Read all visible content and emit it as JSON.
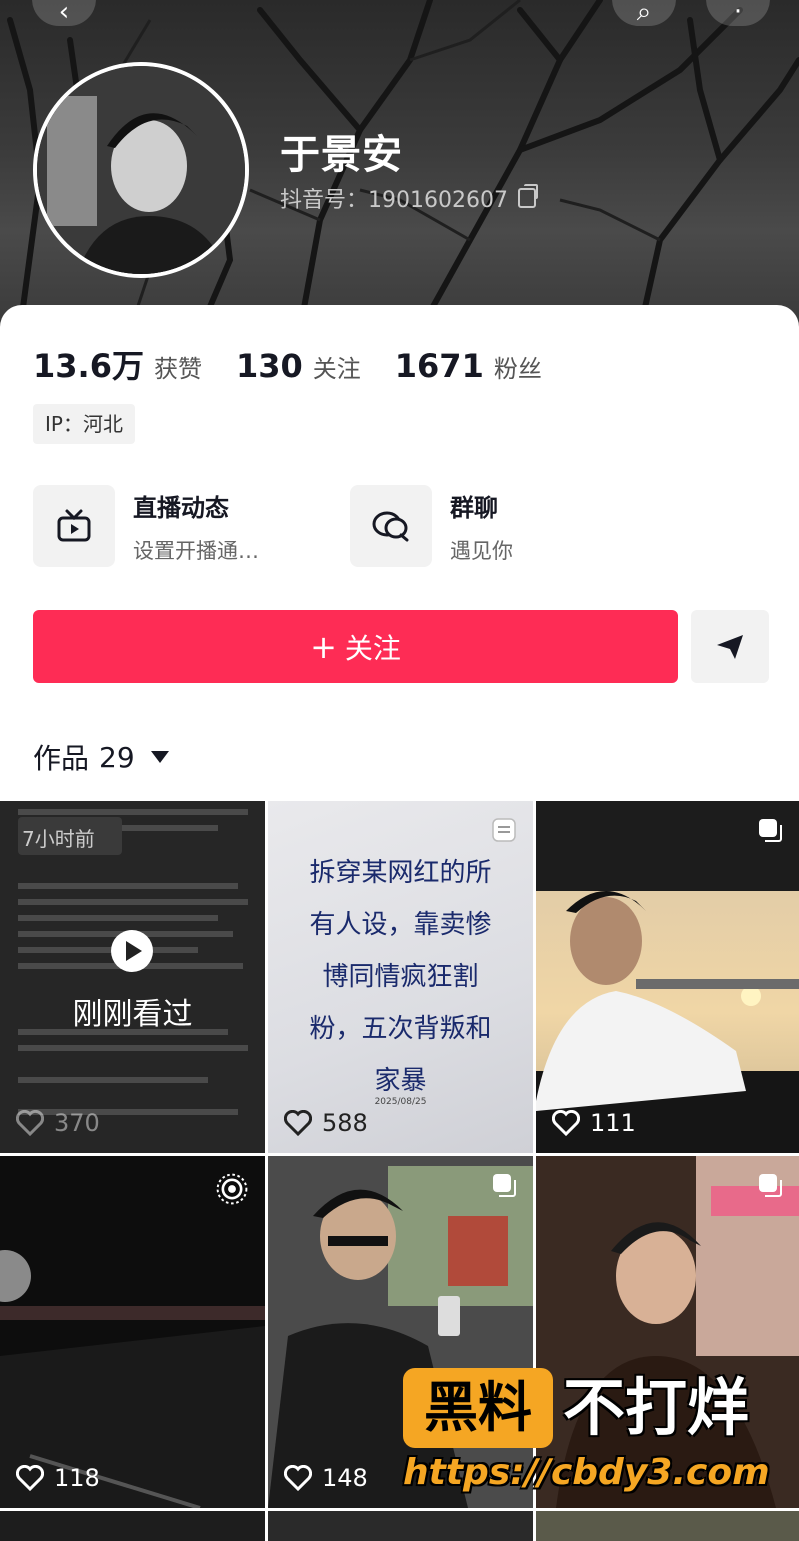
{
  "profile": {
    "name": "于景安",
    "douyin_id": "抖音号：1901602607"
  },
  "stats": [
    {
      "value": "13.6万",
      "label": "获赞"
    },
    {
      "value": "130",
      "label": "关注"
    },
    {
      "value": "1671",
      "label": "粉丝"
    }
  ],
  "ip_tag": "IP：河北",
  "features": [
    {
      "title": "直播动态",
      "subtitle": "设置开播通…",
      "icon": "tv-icon"
    },
    {
      "title": "群聊",
      "subtitle": "遇见你",
      "icon": "chat-bubbles-icon"
    }
  ],
  "follow_button": {
    "plus": "+",
    "label": "关注"
  },
  "works": {
    "label": "作品",
    "count": "29"
  },
  "tiles": [
    {
      "likes": "370",
      "overlay": "刚刚看过",
      "time_tag": "7小时前"
    },
    {
      "likes": "588",
      "title_lines": [
        "拆穿某网红的所",
        "有人设，靠卖惨",
        "博同情疯狂割",
        "粉，五次背叛和",
        "家暴"
      ],
      "date": "2025/08/25"
    },
    {
      "likes": "111"
    },
    {
      "likes": "118"
    },
    {
      "likes": "148"
    },
    {
      "likes": ""
    }
  ],
  "watermark": {
    "box": "黑料",
    "text": "不打烊",
    "url": "https://cbdy3.com"
  },
  "colors": {
    "accent": "#fe2c55",
    "watermark": "#f5a623"
  }
}
